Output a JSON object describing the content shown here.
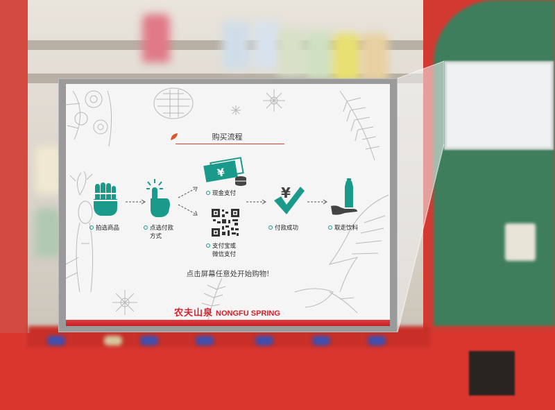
{
  "screen": {
    "title": "购买流程",
    "steps": [
      {
        "id": "select",
        "label": "拍选商品",
        "icon": "hand-select-icon"
      },
      {
        "id": "method",
        "label_line1": "点选付款",
        "label_line2": "方式",
        "icon": "finger-tap-icon"
      },
      {
        "id": "cash",
        "label": "现金支付",
        "icon": "cash-icon"
      },
      {
        "id": "qr",
        "label_line1": "支付宝或",
        "label_line2": "微信支付",
        "icon": "qr-code-icon"
      },
      {
        "id": "success",
        "label": "付款成功",
        "icon": "yuan-check-icon"
      },
      {
        "id": "take",
        "label": "取走饮料",
        "icon": "hand-bottle-icon"
      }
    ],
    "prompt": "点击屏幕任意处开始购物!",
    "brand": {
      "cn": "农夫山泉",
      "en": "NONGFU SPRING"
    }
  },
  "colors": {
    "accent": "#1a9a8a",
    "brand_red": "#d4202a",
    "screen_bg": "#f5f5f5",
    "machine_red": "#c8302a",
    "machine_green": "#3e7e5c"
  }
}
